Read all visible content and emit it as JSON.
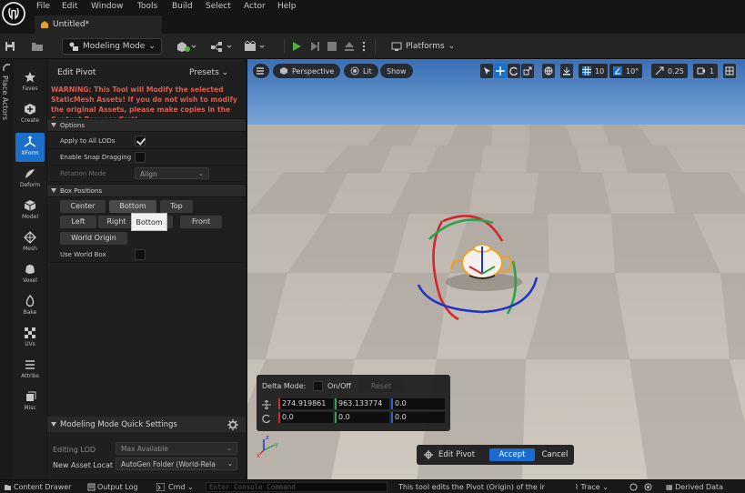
{
  "menu": [
    "File",
    "Edit",
    "Window",
    "Tools",
    "Build",
    "Select",
    "Actor",
    "Help"
  ],
  "tab": {
    "label": "Untitled*"
  },
  "toolbar": {
    "mode_label": "Modeling Mode",
    "platforms_label": "Platforms"
  },
  "left_strip": {
    "label": "Place Actors"
  },
  "tools": [
    {
      "label": "Faves",
      "icon": "star-icon"
    },
    {
      "label": "Create",
      "icon": "create-icon"
    },
    {
      "label": "XForm",
      "icon": "xform-icon",
      "active": true
    },
    {
      "label": "Deform",
      "icon": "deform-icon"
    },
    {
      "label": "Model",
      "icon": "model-icon"
    },
    {
      "label": "Mesh",
      "icon": "mesh-icon"
    },
    {
      "label": "Voxel",
      "icon": "voxel-icon"
    },
    {
      "label": "Bake",
      "icon": "bake-icon"
    },
    {
      "label": "UVs",
      "icon": "uvs-icon"
    },
    {
      "label": "Attribs",
      "icon": "attribs-icon"
    },
    {
      "label": "Misc",
      "icon": "misc-icon"
    }
  ],
  "panel": {
    "title": "Edit Pivot",
    "presets": "Presets",
    "warning": "WARNING: This Tool will Modify the selected StaticMesh Assets! If you do not wish to modify the original Assets, please make copies in the Content Browser first!",
    "options_header": "Options",
    "apply_all_lods": "Apply to All LODs",
    "enable_snap": "Enable Snap Dragging",
    "rotation_mode": "Rotation Mode",
    "rotation_mode_value": "Align",
    "box_positions_header": "Box Positions",
    "box_buttons": {
      "center": "Center",
      "bottom": "Bottom",
      "top": "Top",
      "left": "Left",
      "right": "Right",
      "back_fragment": "k",
      "front": "Front",
      "world_origin": "World Origin"
    },
    "tooltip": "Bottom",
    "use_world_box": "Use World Box",
    "quick_settings_header": "Modeling Mode Quick Settings",
    "editing_lod_label": "Editing LOD",
    "editing_lod_value": "Max Available",
    "new_asset_label": "New Asset Locat",
    "new_asset_value": "AutoGen Folder (World-Rela"
  },
  "viewport": {
    "perspective": "Perspective",
    "lit": "Lit",
    "show": "Show",
    "grid_snap": "10",
    "rot_snap": "10°",
    "scale_snap": "0.25",
    "cam_speed": "1",
    "delta_mode_label": "Delta Mode:",
    "on_off": "On/Off",
    "reset": "Reset",
    "translate": [
      "274.919861",
      "963.133774",
      "0.0"
    ],
    "rotate": [
      "0.0",
      "0.0",
      "0.0"
    ],
    "edit_pivot": "Edit Pivot",
    "accept": "Accept",
    "cancel": "Cancel"
  },
  "statusbar": {
    "content_drawer": "Content Drawer",
    "output_log": "Output Log",
    "cmd": "Cmd",
    "console_placeholder": "Enter Console Command",
    "hint": "This tool edits the Pivot (Origin) of the ir",
    "trace": "Trace",
    "derived_data": "Derived Data"
  },
  "colors": {
    "accent_blue": "#1b6ec9",
    "warning_red": "#e05a4e",
    "play_green": "#4fb13d",
    "sky_top": "#3a6fb6",
    "floor": "#c8c0b6"
  }
}
